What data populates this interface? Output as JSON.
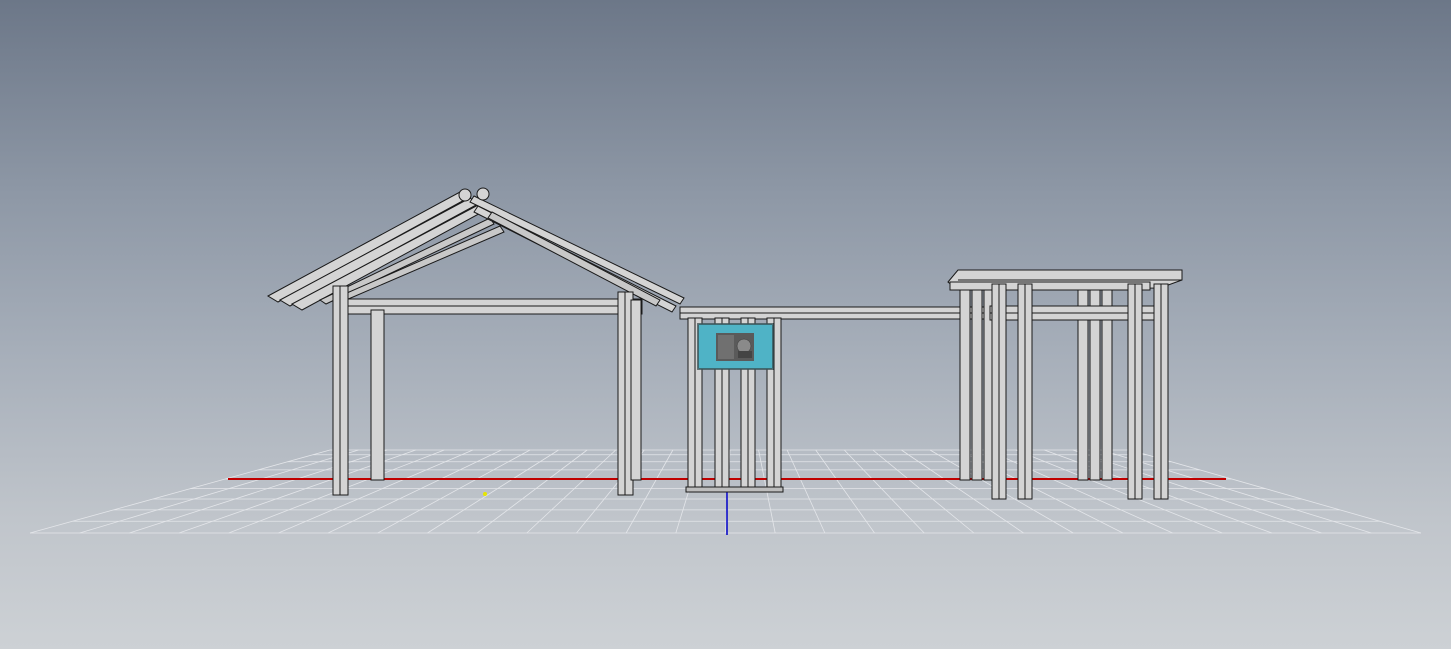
{
  "viewport": {
    "background_top": "#6c7788",
    "background_bottom": "#cdd1d5",
    "grid_color": "#e4e6ea",
    "x_axis_color": "#c00000",
    "z_axis_color": "#0000c8",
    "member_fill": "#d4d4d4",
    "member_stroke": "#1a1a1a"
  },
  "scene": {
    "structures": [
      "gable-roof-pavilion",
      "display-board-frame",
      "flat-roof-pergola"
    ],
    "panel": {
      "color": "#4fb3c6",
      "icon": "display-panel-image"
    },
    "origin_marker_color": "#e6e600"
  }
}
